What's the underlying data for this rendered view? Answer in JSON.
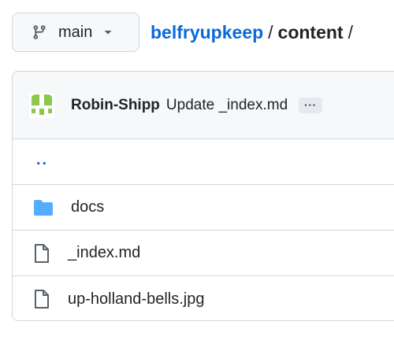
{
  "branch": {
    "name": "main",
    "icon": "git-branch-icon",
    "caret_icon": "triangle-down-icon"
  },
  "breadcrumb": {
    "repo": "belfryupkeep",
    "separator": "/",
    "current": "content",
    "trailing_separator": "/"
  },
  "commit": {
    "author": "Robin-Shipp",
    "message": "Update _index.md",
    "more_label": "···",
    "avatar_color": "#8cc84b"
  },
  "files": {
    "parent_link": "..",
    "items": [
      {
        "name": "docs",
        "type": "folder",
        "icon": "folder-icon"
      },
      {
        "name": "_index.md",
        "type": "file",
        "icon": "file-icon"
      },
      {
        "name": "up-holland-bells.jpg",
        "type": "file",
        "icon": "file-icon"
      }
    ]
  },
  "colors": {
    "link": "#0969da",
    "folder": "#54aeff",
    "border": "#d0d7de",
    "header_bg": "#f6f8fa"
  }
}
